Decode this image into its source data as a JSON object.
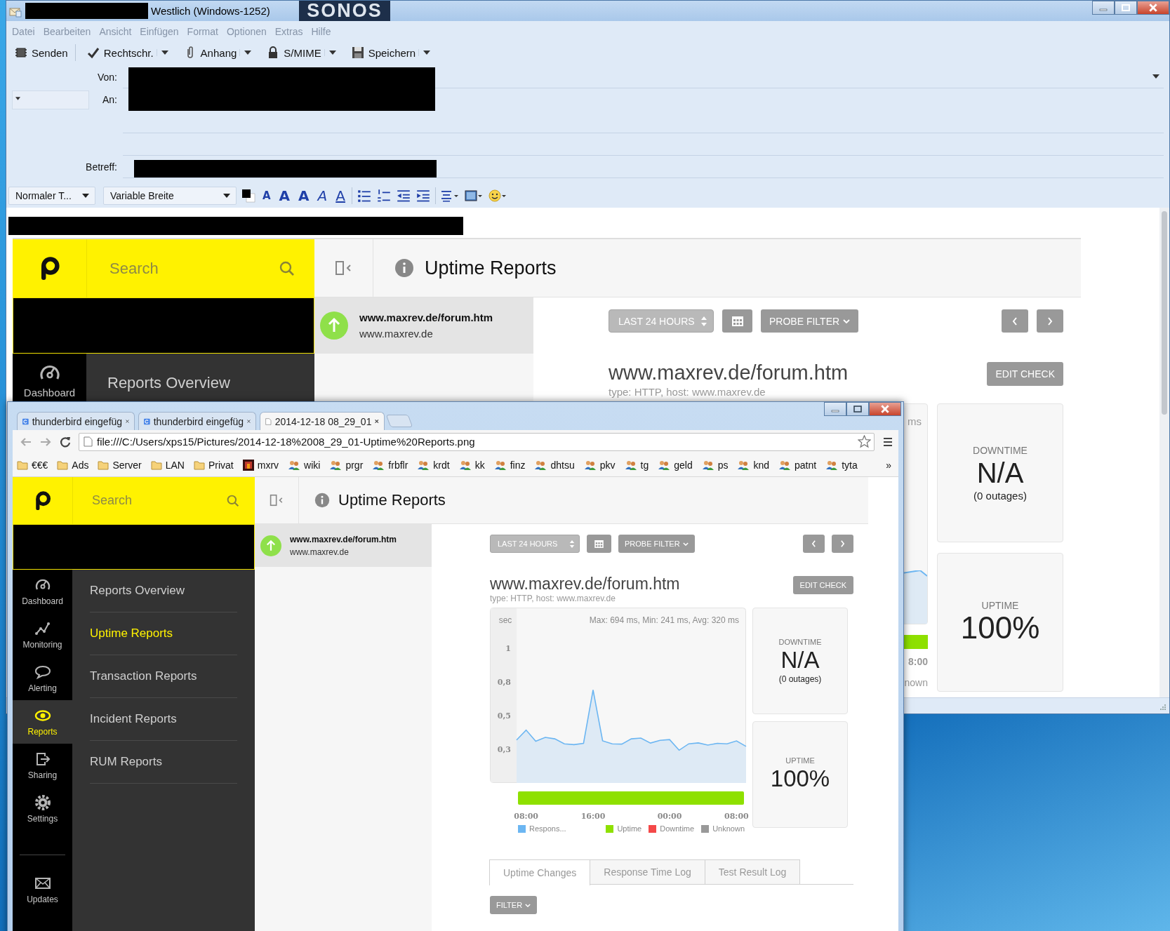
{
  "desktop": {
    "wallpaper_logo": "SONOS"
  },
  "mail_window": {
    "title": "Westlich (Windows-1252)",
    "menu": [
      "Datei",
      "Bearbeiten",
      "Ansicht",
      "Einfügen",
      "Format",
      "Optionen",
      "Extras",
      "Hilfe"
    ],
    "toolbar": [
      {
        "label": "Senden",
        "kind": "send",
        "split": false
      },
      {
        "label": "Rechtschr.",
        "kind": "spell",
        "split": true
      },
      {
        "label": "Anhang",
        "kind": "attach",
        "split": true
      },
      {
        "label": "S/MIME",
        "kind": "lock",
        "split": true
      },
      {
        "label": "Speichern",
        "kind": "save",
        "split": true
      }
    ],
    "header_fields": [
      {
        "label": "Von:",
        "kind": "from"
      },
      {
        "label": "An:",
        "kind": "to"
      },
      {
        "label": "Betreff:",
        "kind": "subject"
      }
    ],
    "paragraph_format": "Normaler T...",
    "font": "Variable Breite",
    "text_style_buttons": [
      {
        "glyph": "A",
        "kind": "smaller"
      },
      {
        "glyph": "A",
        "kind": "larger"
      },
      {
        "glyph": "A",
        "kind": "bold"
      },
      {
        "glyph": "A",
        "kind": "italic"
      },
      {
        "glyph": "A",
        "kind": "underline"
      }
    ],
    "embedded_screenshot": {
      "search_placeholder": "Search",
      "page_title": "Uptime Reports",
      "check_item": {
        "name": "www.maxrev.de/forum.htm",
        "host": "www.maxrev.de"
      },
      "range_select": "LAST 24 HOURS",
      "probe_filter": "PROBE FILTER",
      "check_title": "www.maxrev.de/forum.htm",
      "check_subtitle": "type: HTTP, host: www.maxrev.de",
      "edit_button": "EDIT CHECK",
      "nav_item": "Dashboard",
      "submenu_item": "Reports Overview",
      "chart_fragment": {
        "stats_text": "ms",
        "tick_label": "8:00",
        "legend_label": "nown"
      },
      "stats": [
        {
          "label": "DOWNTIME",
          "value": "N/A",
          "note": "(0 outages)"
        },
        {
          "label": "UPTIME",
          "value": "100%"
        }
      ]
    }
  },
  "browser_window": {
    "tabs": [
      {
        "title": "thunderbird eingefüg",
        "kind": "web",
        "selected": false
      },
      {
        "title": "thunderbird eingefüg",
        "kind": "web",
        "selected": false
      },
      {
        "title": "2014-12-18 08_29_01",
        "kind": "file",
        "selected": true
      }
    ],
    "url": "file:///C:/Users/xps15/Pictures/2014-12-18%2008_29_01-Uptime%20Reports.png",
    "bookmarks": [
      {
        "label": "€€€",
        "kind": "folder"
      },
      {
        "label": "Ads",
        "kind": "folder"
      },
      {
        "label": "Server",
        "kind": "folder"
      },
      {
        "label": "LAN",
        "kind": "folder"
      },
      {
        "label": "Privat",
        "kind": "folder"
      },
      {
        "label": "mxrv",
        "kind": "app"
      },
      {
        "label": "wiki",
        "kind": "people"
      },
      {
        "label": "prgr",
        "kind": "people"
      },
      {
        "label": "frbflr",
        "kind": "people"
      },
      {
        "label": "krdt",
        "kind": "people"
      },
      {
        "label": "kk",
        "kind": "people"
      },
      {
        "label": "finz",
        "kind": "people"
      },
      {
        "label": "dhtsu",
        "kind": "people"
      },
      {
        "label": "pkv",
        "kind": "people"
      },
      {
        "label": "tg",
        "kind": "people"
      },
      {
        "label": "geld",
        "kind": "people"
      },
      {
        "label": "ps",
        "kind": "people"
      },
      {
        "label": "knd",
        "kind": "people"
      },
      {
        "label": "patnt",
        "kind": "people"
      },
      {
        "label": "tyta",
        "kind": "people"
      }
    ],
    "bookmarks_more": "»",
    "app": {
      "search_placeholder": "Search",
      "page_title": "Uptime Reports",
      "nav": [
        {
          "label": "Dashboard",
          "kind": "dashboard",
          "selected": false
        },
        {
          "label": "Monitoring",
          "kind": "monitoring",
          "selected": false
        },
        {
          "label": "Alerting",
          "kind": "alerting",
          "selected": false
        },
        {
          "label": "Reports",
          "kind": "reports",
          "selected": true
        },
        {
          "label": "Sharing",
          "kind": "sharing",
          "selected": false
        },
        {
          "label": "Settings",
          "kind": "settings",
          "selected": false
        }
      ],
      "nav_footer": {
        "label": "Updates"
      },
      "submenu": [
        {
          "label": "Reports Overview",
          "selected": false
        },
        {
          "label": "Uptime Reports",
          "selected": true
        },
        {
          "label": "Transaction Reports",
          "selected": false
        },
        {
          "label": "Incident Reports",
          "selected": false
        },
        {
          "label": "RUM Reports",
          "selected": false
        }
      ],
      "check_item": {
        "name": "www.maxrev.de/forum.htm",
        "host": "www.maxrev.de"
      },
      "range_select": "LAST 24 HOURS",
      "probe_filter": "PROBE FILTER",
      "check_title": "www.maxrev.de/forum.htm",
      "check_subtitle": "type: HTTP, host: www.maxrev.de",
      "edit_button": "EDIT CHECK",
      "chart_data": {
        "type": "area",
        "title": "Max: 694 ms, Min: 241 ms, Avg: 320 ms",
        "ylabel": "sec",
        "categories": [
          null,
          "08:00",
          null,
          null,
          null,
          null,
          null,
          null,
          "16:00",
          null,
          null,
          null,
          null,
          null,
          null,
          null,
          "00:00",
          null,
          null,
          null,
          null,
          null,
          null,
          "08:00",
          null
        ],
        "ylim": [
          0,
          1.3
        ],
        "yticks": [
          {
            "value": 1,
            "label": "1"
          },
          {
            "value": 0.75,
            "label": "0,8"
          },
          {
            "value": 0.5,
            "label": "0,5"
          },
          {
            "value": 0.25,
            "label": "0,3"
          }
        ],
        "series": [
          {
            "name": "Respons...",
            "color": "#6cb6f2",
            "values": [
              0.318,
              0.392,
              0.309,
              0.338,
              0.327,
              0.29,
              0.284,
              0.294,
              0.69,
              0.312,
              0.29,
              0.288,
              0.327,
              0.333,
              0.296,
              0.316,
              0.322,
              0.243,
              0.29,
              0.297,
              0.281,
              0.294,
              0.29,
              0.312,
              0.271
            ]
          }
        ]
      },
      "status_legend": [
        {
          "label": "Uptime",
          "color": "#8ee000"
        },
        {
          "label": "Downtime",
          "color": "#f44848"
        },
        {
          "label": "Unknown",
          "color": "#999999"
        }
      ],
      "stats": [
        {
          "label": "DOWNTIME",
          "value": "N/A",
          "note": "(0 outages)"
        },
        {
          "label": "UPTIME",
          "value": "100%"
        }
      ],
      "log_tabs": [
        {
          "label": "Uptime Changes",
          "selected": true
        },
        {
          "label": "Response Time Log",
          "selected": false
        },
        {
          "label": "Test Result Log",
          "selected": false
        }
      ],
      "filter_button": "FILTER"
    }
  }
}
